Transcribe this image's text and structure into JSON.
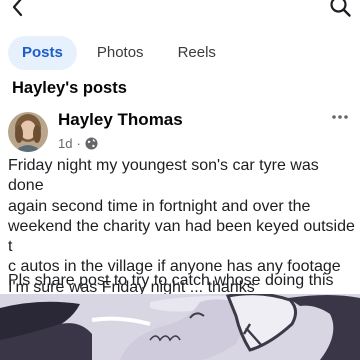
{
  "icons": {
    "back": "chevron-left-icon",
    "search": "search-icon",
    "more": "more-horizontal-icon",
    "audience": "globe-icon"
  },
  "tabs": [
    {
      "label": "Posts",
      "active": true
    },
    {
      "label": "Photos",
      "active": false
    },
    {
      "label": "Reels",
      "active": false
    }
  ],
  "section": {
    "title": "Hayley's posts"
  },
  "post": {
    "author": "Hayley Thomas",
    "time": "1d",
    "body": "Friday night my youngest son's car tyre was done\nagain second time in fortnight and over the\nweekend the charity van had been keyed outside t\nc autos in the village  if anyone has any footage\nI'm sure was Friday night ... thanks",
    "share_line": "Pls share post to try to catch whose doing this"
  },
  "colors": {
    "accent": "#1b5ec9",
    "tab_active_bg": "#e7f0fd",
    "secondary_text": "#65676b"
  }
}
